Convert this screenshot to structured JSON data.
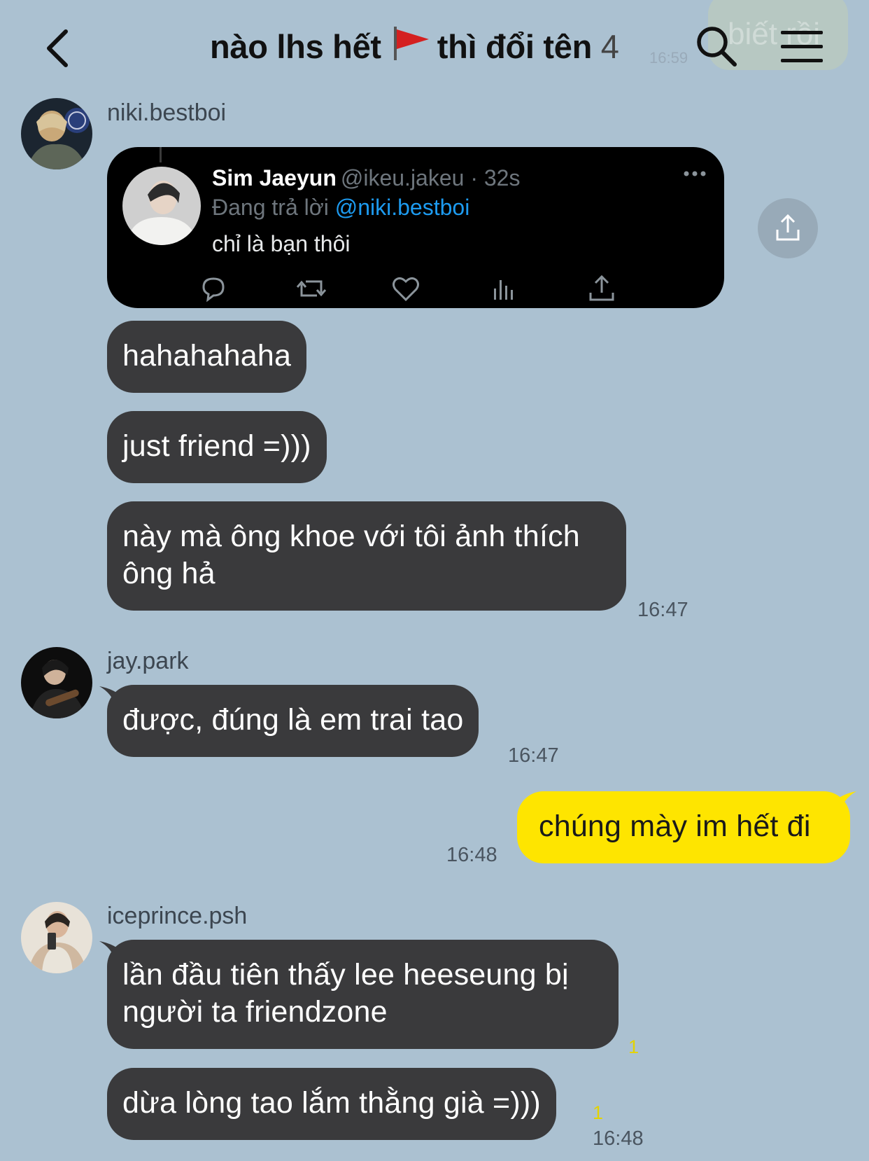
{
  "header": {
    "title_before_flag": "nào lhs hết",
    "title_after_flag": "thì đổi tên",
    "member_count": "4",
    "back_icon": "chevron-left-icon",
    "flag_icon": "red-flag-icon",
    "search_icon": "search-icon",
    "menu_icon": "hamburger-menu-icon"
  },
  "ghost": {
    "text": "biết rồi",
    "time": "16:59"
  },
  "colors": {
    "background": "#abc1d1",
    "bubble_other": "#3a3a3c",
    "bubble_mine": "#fee500",
    "unread": "#e3d300"
  },
  "messages": {
    "niki": {
      "sender": "niki.bestboi",
      "tweet": {
        "author": "Sim Jaeyun",
        "handle_time": "@ikeu.jakeu · 32s",
        "replying_prefix": "Đang trả lời",
        "replying_to": "@niki.bestboi",
        "text": "chỉ là bạn thôi"
      },
      "m1": "hahahahaha",
      "m2": "just friend =)))",
      "m3_line1": "này mà ông khoe với tôi ảnh thích",
      "m3_line2": "ông hả",
      "time": "16:47"
    },
    "jay": {
      "sender": "jay.park",
      "m1": "được, đúng là em trai tao",
      "time": "16:47"
    },
    "me": {
      "m1": "chúng mày im hết đi",
      "time": "16:48"
    },
    "ice": {
      "sender": "iceprince.psh",
      "m1_line1": "lần đầu tiên thấy lee heeseung bị",
      "m1_line2": "người ta friendzone",
      "m1_unread": "1",
      "m2": "dừa lòng tao lắm thằng già =)))",
      "m2_unread": "1",
      "time": "16:48"
    }
  }
}
